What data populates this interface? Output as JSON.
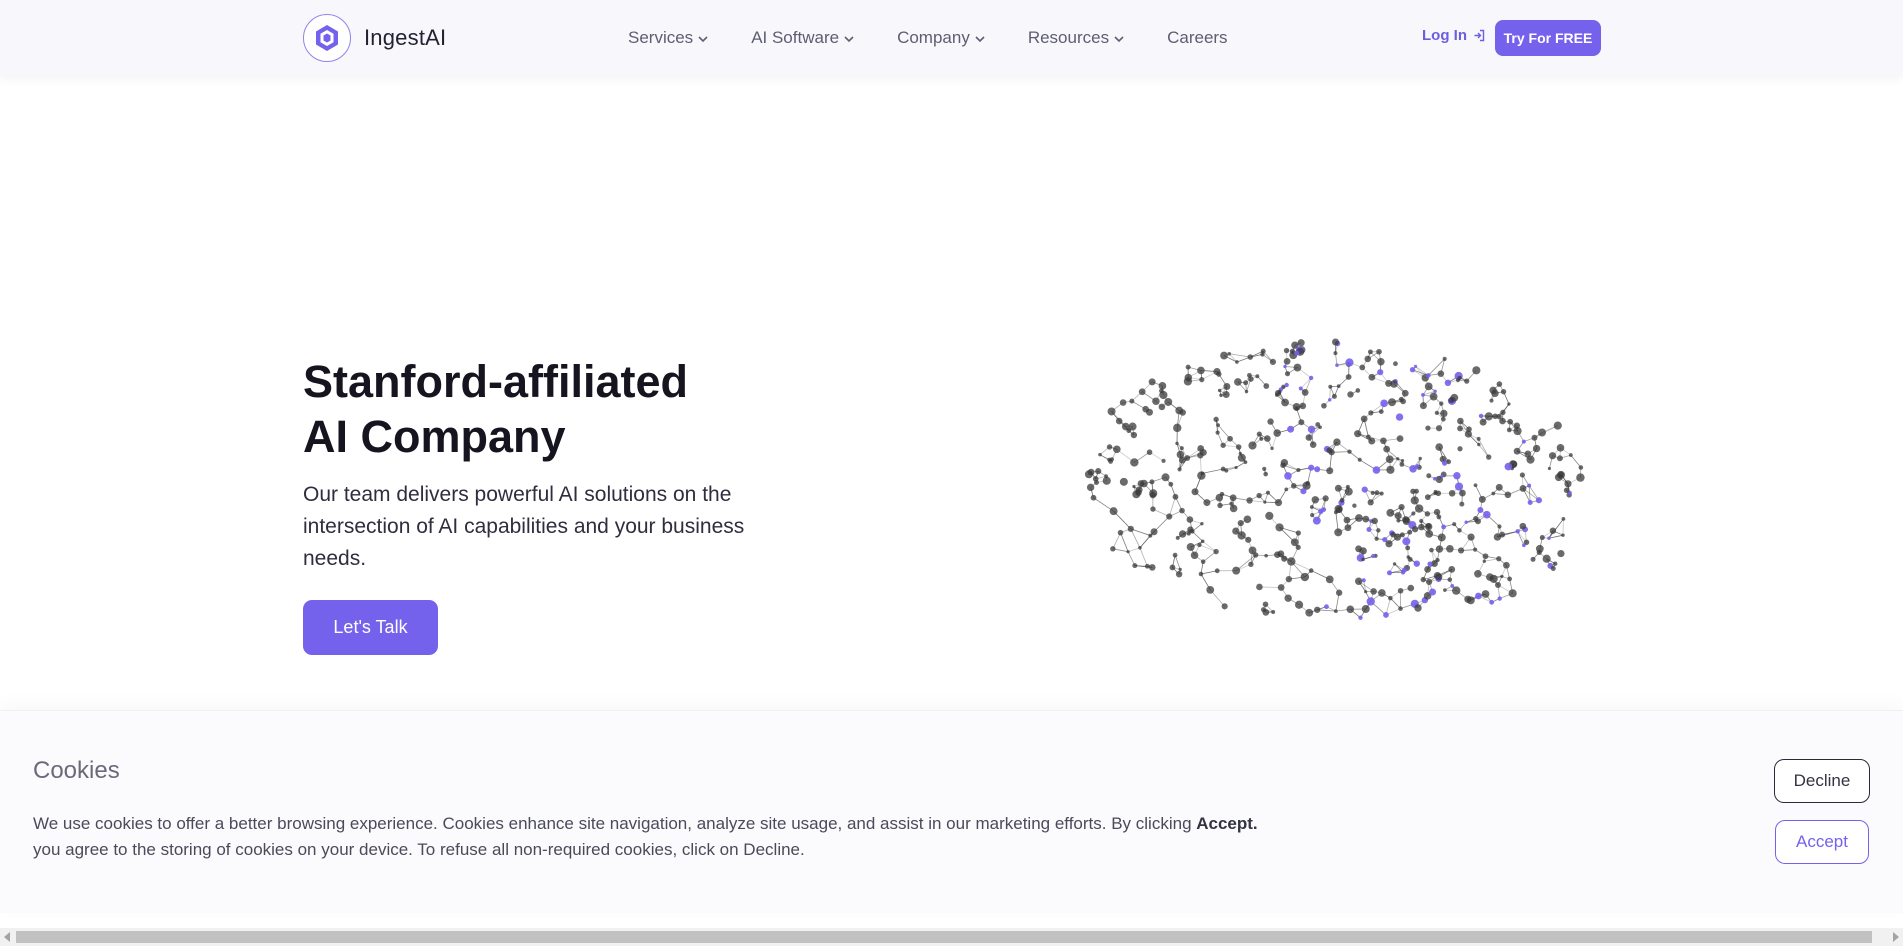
{
  "brand": {
    "name": "IngestAI",
    "logo_icon": "hexagon-logo-icon",
    "accent_color": "#7462ec"
  },
  "nav": {
    "items": [
      {
        "label": "Services",
        "has_dropdown": true
      },
      {
        "label": "AI Software",
        "has_dropdown": true
      },
      {
        "label": "Company",
        "has_dropdown": true
      },
      {
        "label": "Resources",
        "has_dropdown": true
      },
      {
        "label": "Careers",
        "has_dropdown": false
      }
    ],
    "login_label": "Log In",
    "login_icon": "sign-in-icon",
    "try_label": "Try For FREE"
  },
  "hero": {
    "title_line1": "Stanford-affiliated",
    "title_line2": "AI Company",
    "subtitle": "Our team delivers powerful AI solutions on the intersection of AI capabilities and your business needs.",
    "cta_label": "Let's Talk",
    "graphic": "neural-network-brain-graphic",
    "node_colors": [
      "#3a3a3a",
      "#7462ec"
    ]
  },
  "cookie": {
    "title": "Cookies",
    "text_before": "We use cookies to offer a better browsing experience. Cookies enhance site navigation, analyze site usage, and assist in our marketing efforts. By clicking ",
    "text_bold": "Accept.",
    "text_after": " you agree to the storing of cookies on your device. To refuse all non-required cookies, click on Decline.",
    "decline_label": "Decline",
    "accept_label": "Accept"
  }
}
